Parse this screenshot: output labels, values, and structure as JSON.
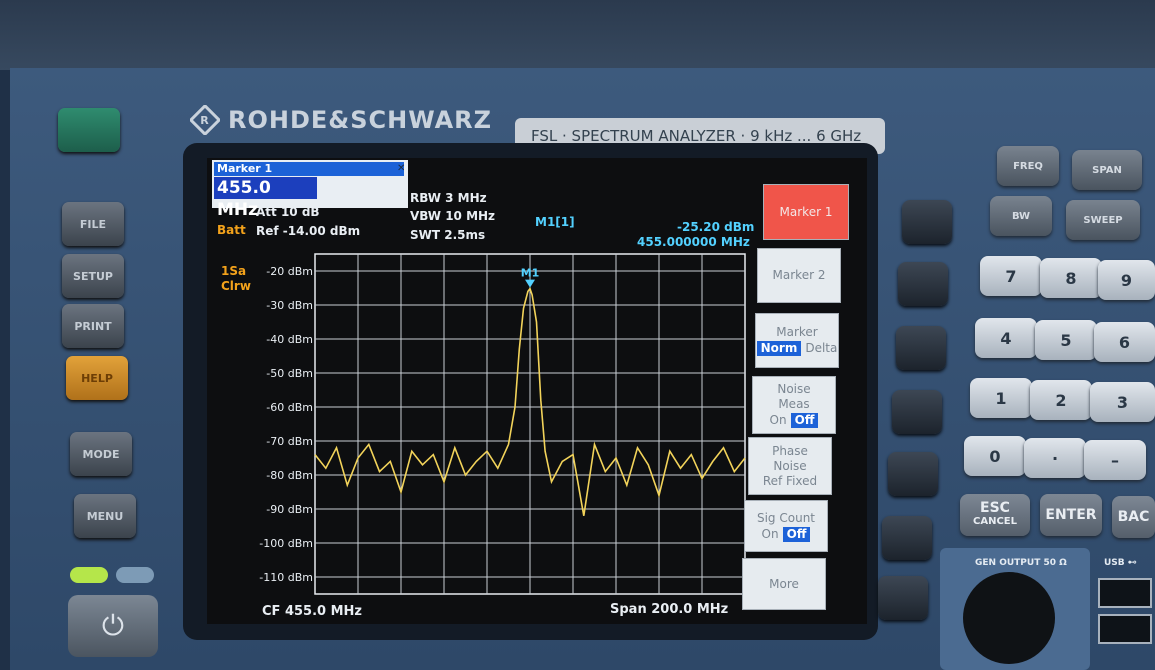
{
  "brand": {
    "name": "ROHDE&SCHWARZ",
    "model": "FSL · SPECTRUM ANALYZER · 9 kHz ... 6 GHz"
  },
  "left_keys": [
    "FILE",
    "SETUP",
    "PRINT",
    "HELP",
    "MODE",
    "MENU"
  ],
  "dialog": {
    "title": "Marker 1",
    "value": "455.0 MHz",
    "close": "✕"
  },
  "settings": {
    "att": "Att   10 dB",
    "ref": "Ref  -14.00 dBm",
    "batt": "Batt",
    "rbw": "RBW 3 MHz",
    "vbw": "VBW 10 MHz",
    "swt": "SWT 2.5ms",
    "trace_mode": "1Sa",
    "trace_det": "Clrw"
  },
  "marker": {
    "label": "M1[1]",
    "level": "-25.20 dBm",
    "freq": "455.000000 MHz",
    "tag": "M1"
  },
  "footer": {
    "cf": "CF 455.0 MHz",
    "span": "Span 200.0 MHz"
  },
  "y_ticks": [
    "-20 dBm",
    "-30 dBm",
    "-40 dBm",
    "-50 dBm",
    "-60 dBm",
    "-70 dBm",
    "-80 dBm",
    "-90 dBm",
    "-100 dBm",
    "-110 dBm"
  ],
  "softkeys": {
    "marker1": "Marker 1",
    "marker2": "Marker 2",
    "marker_mode": {
      "title": "Marker",
      "a": "Norm",
      "b": "Delta"
    },
    "noise": {
      "title1": "Noise",
      "title2": "Meas",
      "a": "On",
      "b": "Off"
    },
    "phase": {
      "l1": "Phase",
      "l2": "Noise",
      "l3": "Ref Fixed",
      "arrow": "⇩"
    },
    "sigcount": {
      "title": "Sig Count",
      "a": "On",
      "b": "Off"
    },
    "more": "More",
    "more_arrow": "⇩"
  },
  "keypad": {
    "func": [
      "FREQ",
      "SPAN",
      "BW",
      "SWEEP"
    ],
    "digits": [
      "7",
      "8",
      "9",
      "4",
      "5",
      "6",
      "1",
      "2",
      "3",
      "0",
      "·",
      "–"
    ],
    "esc": "ESC",
    "cancel": "CANCEL",
    "enter": "ENTER",
    "back": "BAC"
  },
  "ports": {
    "gen": "GEN OUTPUT 50 Ω",
    "usb": "USB ⊷"
  },
  "chart_data": {
    "type": "line",
    "title": "",
    "xlabel": "",
    "ylabel": "",
    "x_range_mhz": [
      355,
      555
    ],
    "ylim": [
      -115,
      -15
    ],
    "grid": true,
    "series": [
      {
        "x": [
          355,
          360,
          365,
          370,
          375,
          380,
          385,
          390,
          395,
          400,
          405,
          410,
          415,
          420,
          425,
          430,
          435,
          440,
          445,
          448,
          450,
          452,
          454,
          455,
          456,
          458,
          460,
          462,
          465,
          470,
          475,
          480,
          485,
          490,
          495,
          500,
          505,
          510,
          515,
          520,
          525,
          530,
          535,
          540,
          545,
          550,
          555
        ],
        "values": [
          -74,
          -78,
          -72,
          -83,
          -75,
          -71,
          -79,
          -76,
          -85,
          -73,
          -77,
          -74,
          -82,
          -72,
          -80,
          -76,
          -73,
          -78,
          -71,
          -60,
          -43,
          -31,
          -26,
          -25.2,
          -27,
          -35,
          -58,
          -73,
          -82,
          -76,
          -74,
          -92,
          -71,
          -79,
          -75,
          -83,
          -72,
          -77,
          -86,
          -73,
          -78,
          -74,
          -81,
          -76,
          -72,
          -79,
          -75
        ]
      }
    ]
  }
}
